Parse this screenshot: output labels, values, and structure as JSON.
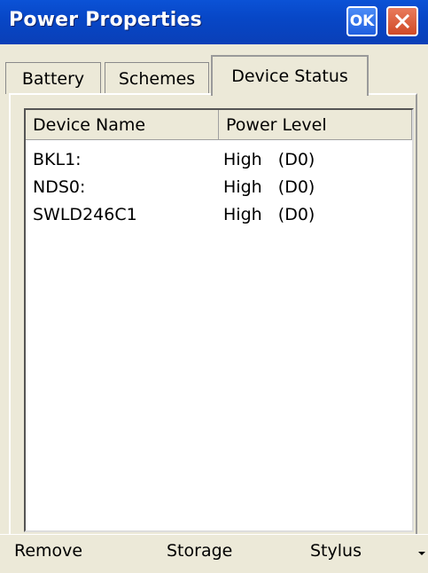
{
  "window": {
    "title": "Power Properties",
    "ok_label": "OK"
  },
  "tabs": [
    {
      "label": "Battery"
    },
    {
      "label": "Schemes"
    },
    {
      "label": "Device Status"
    }
  ],
  "device_list": {
    "columns": [
      "Device Name",
      "Power Level"
    ],
    "rows": [
      {
        "name": "BKL1:",
        "level": "High   (D0)"
      },
      {
        "name": "NDS0:",
        "level": "High   (D0)"
      },
      {
        "name": "SWLD246C1",
        "level": "High   (D0)"
      }
    ]
  },
  "bottom_bar": {
    "items": [
      {
        "label": "Remove"
      },
      {
        "label": "Storage"
      },
      {
        "label": "Stylus"
      }
    ]
  },
  "colors": {
    "titlebar": "#0747c7",
    "close_button": "#d04a27",
    "ok_button": "#1f5fe0",
    "dialog_bg": "#ece9d8"
  }
}
